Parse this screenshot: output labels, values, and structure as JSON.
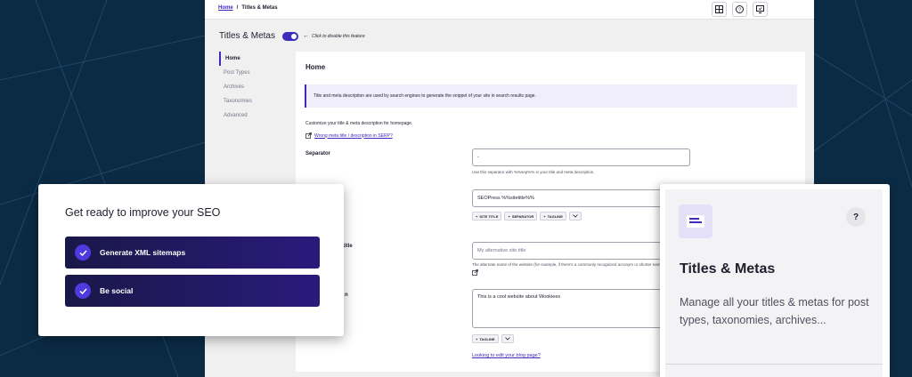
{
  "colors": {
    "background": "#0b2b45",
    "accent": "#3c2bbd",
    "task_gradient_start": "#1a1848",
    "task_gradient_end": "#2a1a7c"
  },
  "breadcrumb": {
    "home": "Home",
    "separator": "/",
    "current": "Titles & Metas"
  },
  "toolbar": {
    "icons": [
      "grid-icon",
      "help-circle-icon",
      "display-icon"
    ]
  },
  "header": {
    "title": "Titles & Metas",
    "toggle_on": true,
    "toggle_hint": "Click to disable this feature"
  },
  "sidebar": {
    "items": [
      {
        "label": "Home",
        "active": true
      },
      {
        "label": "Post Types",
        "active": false
      },
      {
        "label": "Archives",
        "active": false
      },
      {
        "label": "Taxonomies",
        "active": false
      },
      {
        "label": "Advanced",
        "active": false
      }
    ]
  },
  "main": {
    "title": "Home",
    "notice": "Title and meta description are used by search engines to generate the snippet of your site in search results page.",
    "intro": "Customize your title & meta description for homepage.",
    "serp_link": "Wrong meta title / description in SERP?",
    "separator": {
      "label": "Separator",
      "value": "-",
      "help": "Use this separator with %%sep%% in your title and meta description."
    },
    "site_title": {
      "value": "SEOPress %%sitetitle%%",
      "tags": [
        "SITE TITLE",
        "SEPARATOR",
        "TAGLINE"
      ]
    },
    "alt_title": {
      "label_fragment": "title",
      "placeholder": "My alternative site title",
      "help": "The alternate name of the website (for example, if there's a commonly recognized acronym or shorter name for your site), if a"
    },
    "description": {
      "label_fragment": "n",
      "value": "This is a cool website about Wookiees",
      "tags": [
        "TAGLINE"
      ]
    },
    "blog_link": "Looking to edit your blog page?"
  },
  "seo_card": {
    "title": "Get ready to improve your SEO",
    "tasks": [
      {
        "label": "Generate XML sitemaps",
        "checked": true
      },
      {
        "label": "Be social",
        "checked": true
      }
    ]
  },
  "feature_card": {
    "icon": "titles-icon",
    "help": "?",
    "title": "Titles & Metas",
    "description": "Manage all your titles & metas for post types, taxonomies, archives..."
  }
}
